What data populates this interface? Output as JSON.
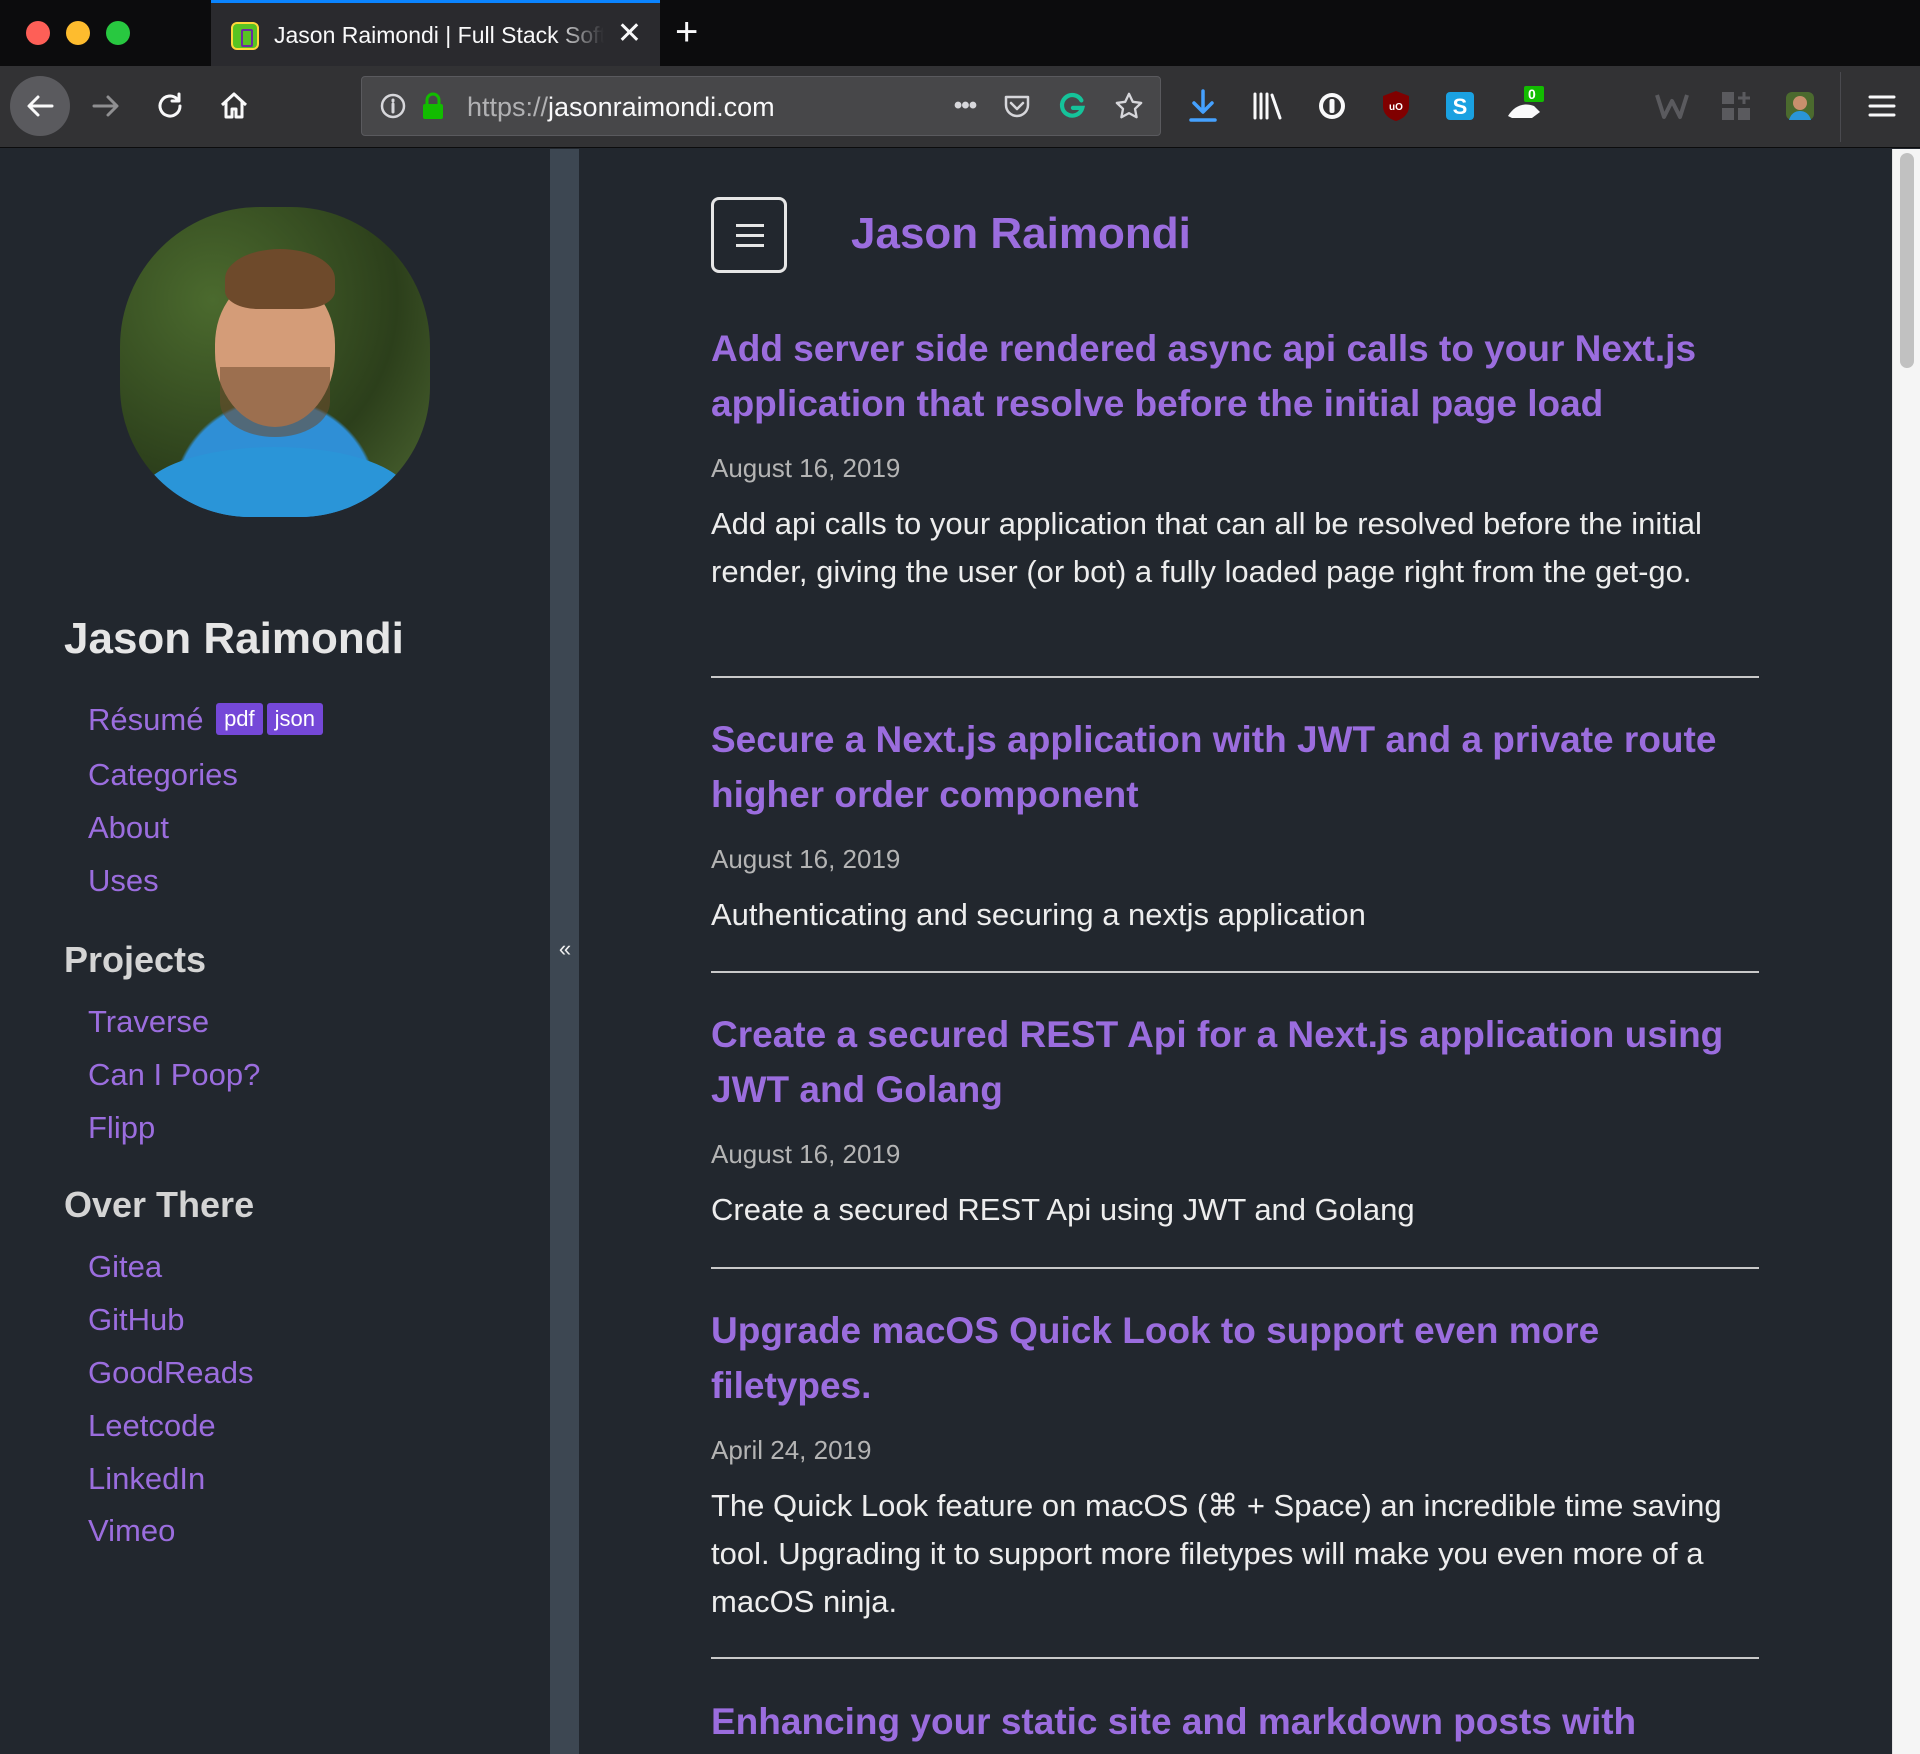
{
  "browser": {
    "tab_title": "Jason Raimondi | Full Stack Software Developer",
    "url_scheme": "https://",
    "url_domain": "jasonraimondi.com",
    "page_actions": "•••",
    "extension_badge": "0"
  },
  "sidebar": {
    "name": "Jason Raimondi",
    "links": [
      {
        "label": "Résumé"
      },
      {
        "label": "Categories"
      },
      {
        "label": "About"
      },
      {
        "label": "Uses"
      }
    ],
    "resume_badges": [
      "pdf",
      "json"
    ],
    "projects_heading": "Projects",
    "projects": [
      {
        "label": "Traverse"
      },
      {
        "label": "Can I Poop?"
      },
      {
        "label": "Flipp"
      }
    ],
    "over_there_heading": "Over There",
    "over_there": [
      {
        "label": "Gitea"
      },
      {
        "label": "GitHub"
      },
      {
        "label": "GoodReads"
      },
      {
        "label": "Leetcode"
      },
      {
        "label": "LinkedIn"
      },
      {
        "label": "Vimeo"
      }
    ],
    "collapse_glyph": "«"
  },
  "main": {
    "site_title": "Jason Raimondi",
    "posts": [
      {
        "title": "Add server side rendered async api calls to your Next.js application that resolve before the initial page load",
        "date": "August 16, 2019",
        "description": "Add api calls to your application that can all be resolved before the initial render, giving the user (or bot) a fully loaded page right from the get-go."
      },
      {
        "title": "Secure a Next.js application with JWT and a private route higher order component",
        "date": "August 16, 2019",
        "description": "Authenticating and securing a nextjs application"
      },
      {
        "title": "Create a secured REST Api for a Next.js application using JWT and Golang",
        "date": "August 16, 2019",
        "description": "Create a secured REST Api using JWT and Golang"
      },
      {
        "title": "Upgrade macOS Quick Look to support even more filetypes.",
        "date": "April 24, 2019",
        "description": "The Quick Look feature on macOS (⌘ + Space) an incredible time saving tool. Upgrading it to support more filetypes will make you even more of a macOS ninja."
      },
      {
        "title": "Enhancing your static site and markdown posts with",
        "date": "",
        "description": ""
      }
    ]
  },
  "colors": {
    "accent": "#9b6dde",
    "background": "#22272e",
    "badge": "#7548d8"
  }
}
